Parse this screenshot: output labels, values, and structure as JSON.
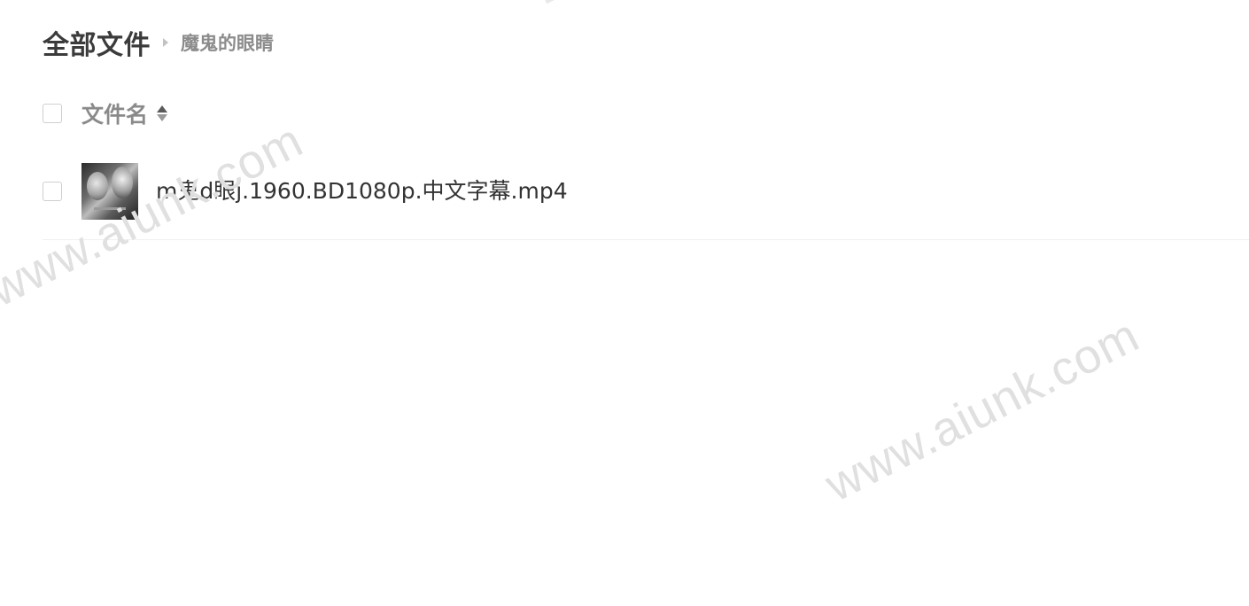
{
  "breadcrumb": {
    "root": "全部文件",
    "current": "魔鬼的眼睛"
  },
  "list_header": {
    "name_label": "文件名"
  },
  "files": [
    {
      "name": "m鬼d眼j.1960.BD1080p.中文字幕.mp4",
      "type_icon": "video-thumbnail"
    }
  ],
  "watermark": {
    "text": "www.aiunk.com"
  }
}
